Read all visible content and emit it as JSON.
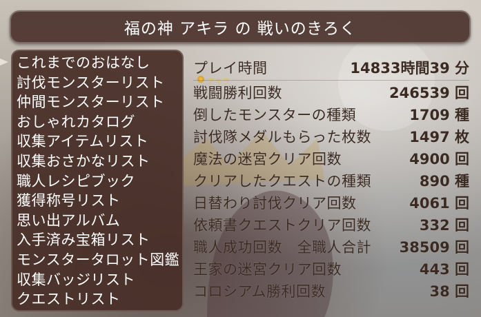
{
  "title": "福の神 アキラ の 戦いのきろく",
  "menu": {
    "items": [
      "これまでのおはなし",
      "討伐モンスターリスト",
      "仲間モンスターリスト",
      "おしゃれカタログ",
      "収集アイテムリスト",
      "収集おさかなリスト",
      "職人レシピブック",
      "獲得称号リスト",
      "思い出アルバム",
      "入手済み宝箱リスト",
      "モンスタータロット図鑑",
      "収集バッジリスト",
      "クエストリスト"
    ]
  },
  "overlay_name": "アキラ",
  "stats": {
    "playtime_label": "プレイ時間",
    "playtime_value": "14833時間39 分",
    "rows": [
      {
        "label": "戦闘勝利回数",
        "value": "246539 回"
      },
      {
        "label": "倒したモンスターの種類",
        "value": "1709 種"
      },
      {
        "label": "討伐隊メダルもらった枚数",
        "value": "1497 枚"
      },
      {
        "label": "魔法の迷宮クリア回数",
        "value": "4900 回"
      },
      {
        "label": "クリアしたクエストの種類",
        "value": "890 種"
      },
      {
        "label": "日替わり討伐クリア回数",
        "value": "4061 回"
      },
      {
        "label": "依頼書クエストクリア回数",
        "value": "332 回"
      },
      {
        "label": "職人成功回数　全職人合計",
        "value": "38509 回"
      },
      {
        "label": "王家の迷宮クリア回数",
        "value": "443 回"
      },
      {
        "label": "コロシアム勝利回数",
        "value": "38 回"
      }
    ]
  }
}
